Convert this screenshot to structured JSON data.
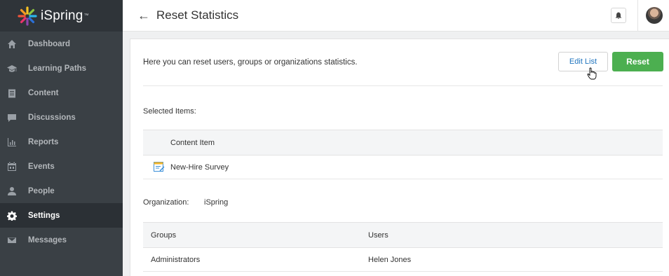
{
  "app": {
    "logo_text": "iSpring",
    "logo_tm": "™"
  },
  "sidebar": {
    "items": [
      {
        "label": "Dashboard",
        "icon": "home-icon"
      },
      {
        "label": "Learning Paths",
        "icon": "graduation-cap-icon"
      },
      {
        "label": "Content",
        "icon": "clipboard-icon"
      },
      {
        "label": "Discussions",
        "icon": "chat-icon"
      },
      {
        "label": "Reports",
        "icon": "bar-chart-icon"
      },
      {
        "label": "Events",
        "icon": "calendar-icon"
      },
      {
        "label": "People",
        "icon": "person-icon"
      },
      {
        "label": "Settings",
        "icon": "gear-icon",
        "active": true
      },
      {
        "label": "Messages",
        "icon": "envelope-icon"
      }
    ]
  },
  "header": {
    "back": "←",
    "title": "Reset Statistics"
  },
  "main": {
    "intro": "Here you can reset users, groups or organizations statistics.",
    "edit_list_label": "Edit List",
    "reset_label": "Reset",
    "selected_items_label": "Selected Items:",
    "content_table": {
      "header": "Content Item",
      "rows": [
        {
          "name": "New-Hire Survey",
          "icon": "survey-icon"
        }
      ]
    },
    "organization": {
      "label": "Organization:",
      "value": "iSpring"
    },
    "groups_table": {
      "headers": [
        "Groups",
        "Users"
      ],
      "rows": [
        {
          "group": "Administrators",
          "user": "Helen Jones"
        }
      ]
    }
  },
  "colors": {
    "sidebar": "#3a4045",
    "accent_green": "#4caf50",
    "link_blue": "#1e73be"
  }
}
